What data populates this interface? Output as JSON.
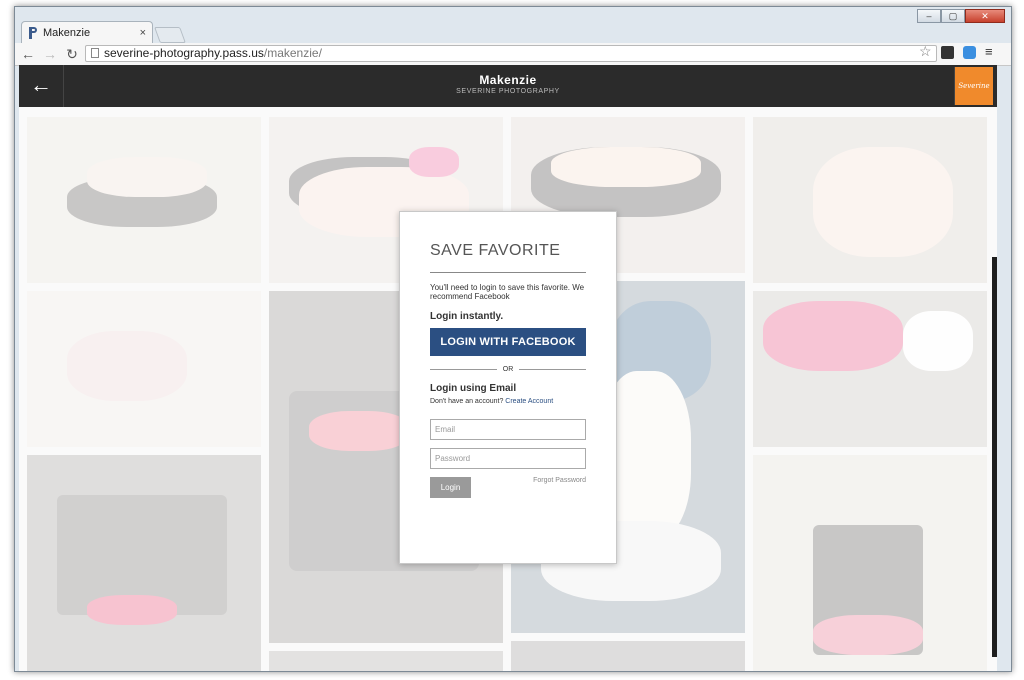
{
  "browser": {
    "tab_title": "Makenzie",
    "tab_close": "×",
    "url_host": "severine-photography.pass.us",
    "url_path": "/makenzie/",
    "window_controls": [
      "‒",
      "▢",
      "✕"
    ]
  },
  "app": {
    "back_arrow": "🡐",
    "title": "Makenzie",
    "subtitle": "SEVERINE PHOTOGRAPHY",
    "logo_text": "Severine"
  },
  "modal": {
    "title": "SAVE FAVORITE",
    "note": "You'll need to login to save this favorite. We recommend Facebook",
    "login_instantly": "Login instantly.",
    "facebook_button": "LOGIN WITH FACEBOOK",
    "or_label": "OR",
    "email_heading": "Login using Email",
    "no_account": "Don't have an account?",
    "create_account": "Create Account",
    "email_placeholder": "Email",
    "password_placeholder": "Password",
    "login_button": "Login",
    "forgot_password": "Forgot Password"
  },
  "colors": {
    "appbar": "#2b2b2b",
    "facebook_blue": "#2b4f82",
    "logo_orange": "#f08a2c"
  }
}
